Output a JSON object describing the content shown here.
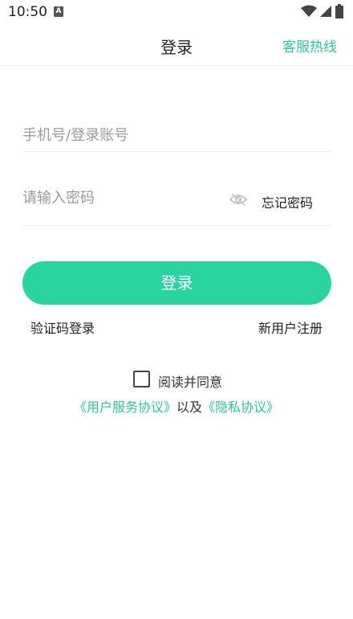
{
  "status_bar": {
    "time": "10:50",
    "notification_icon_letter": "A"
  },
  "header": {
    "title": "登录",
    "hotline": "客服热线"
  },
  "form": {
    "account_placeholder": "手机号/登录账号",
    "password_placeholder": "请输入密码",
    "forgot_password": "忘记密码",
    "login_button": "登录",
    "sms_login": "验证码登录",
    "register": "新用户注册"
  },
  "agreement": {
    "label": "阅读并同意",
    "user_agreement": "《用户服务协议》",
    "separator": "以及",
    "privacy_policy": "《隐私协议》",
    "checked": false
  },
  "colors": {
    "accent": "#2bd3a0",
    "link": "#2bc79a"
  }
}
